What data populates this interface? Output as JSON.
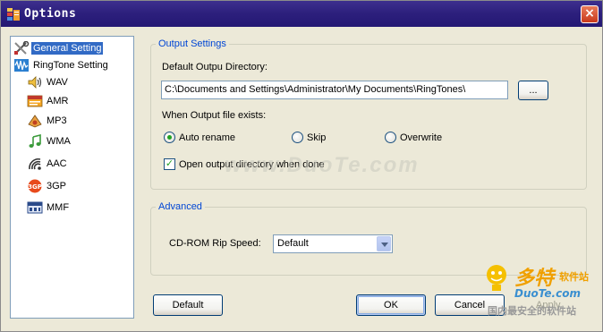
{
  "window": {
    "title": "Options",
    "close_symbol": "×"
  },
  "tree": {
    "items": [
      {
        "label": "General Setting",
        "icon": "tools-icon",
        "selected": true
      },
      {
        "label": "RingTone Setting",
        "icon": "waveform-icon"
      },
      {
        "label": "WAV",
        "icon": "speaker-icon"
      },
      {
        "label": "AMR",
        "icon": "amr-icon"
      },
      {
        "label": "MP3",
        "icon": "mp3-icon"
      },
      {
        "label": "WMA",
        "icon": "music-note-icon"
      },
      {
        "label": "AAC",
        "icon": "aac-icon"
      },
      {
        "label": "3GP",
        "icon": "3gp-icon"
      },
      {
        "label": "MMF",
        "icon": "mmf-icon"
      }
    ]
  },
  "output_settings": {
    "group_title": "Output Settings",
    "directory_label": "Default Outpu Directory:",
    "directory_value": "C:\\Documents and Settings\\Administrator\\My Documents\\RingTones\\",
    "browse_label": "...",
    "exists_label": "When Output file exists:",
    "radios": [
      {
        "label": "Auto rename",
        "checked": true
      },
      {
        "label": "Skip",
        "checked": false
      },
      {
        "label": "Overwrite",
        "checked": false
      }
    ],
    "open_dir_label": "Open output directory when done",
    "open_dir_checked": true,
    "checkmark": "✓"
  },
  "advanced": {
    "group_title": "Advanced",
    "rip_speed_label": "CD-ROM Rip Speed:",
    "rip_speed_value": "Default"
  },
  "buttons": {
    "default_label": "Default",
    "ok_label": "OK",
    "cancel_label": "Cancel",
    "apply_label": "Apply"
  },
  "watermarks": {
    "center": "www.DuoTe.com",
    "logo_text": "多特",
    "logo_sub": "软件站",
    "logo_domain": "DuoTe.com",
    "logo_tagline": "国内最安全的软件站"
  }
}
